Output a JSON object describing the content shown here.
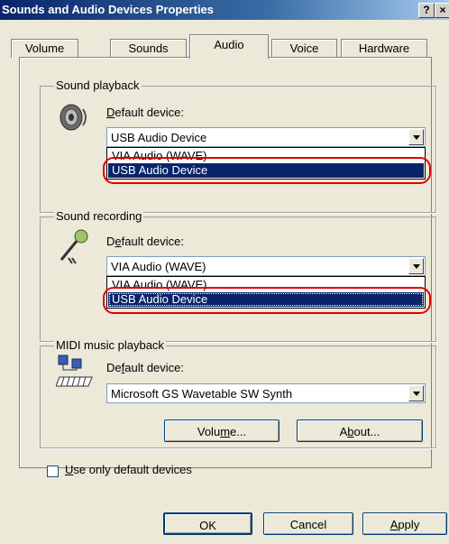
{
  "window": {
    "title": "Sounds and Audio Devices Properties",
    "help_glyph": "?",
    "close_glyph": "×"
  },
  "tabs": [
    "Volume",
    "Sounds",
    "Audio",
    "Voice",
    "Hardware"
  ],
  "active_tab": "Audio",
  "playback": {
    "group_label": "Sound playback",
    "default_label_prefix": "",
    "default_label_mnemonic": "D",
    "default_label_rest": "efault device:",
    "selected": "USB Audio Device",
    "options": [
      "VIA Audio (WAVE)",
      "USB Audio Device"
    ],
    "highlighted": "USB Audio Device",
    "icon": "speaker-icon"
  },
  "recording": {
    "group_label": "Sound recording",
    "default_label_prefix": "D",
    "default_label_mnemonic": "e",
    "default_label_rest": "fault device:",
    "selected": "VIA Audio (WAVE)",
    "options": [
      "VIA Audio (WAVE)",
      "USB Audio Device"
    ],
    "highlighted": "USB Audio Device",
    "icon": "microphone-icon"
  },
  "midi": {
    "group_label": "MIDI music playback",
    "default_label_prefix": "De",
    "default_label_mnemonic": "f",
    "default_label_rest": "ault device:",
    "selected": "Microsoft GS Wavetable SW Synth",
    "icon": "midi-keyboard-icon",
    "volume_prefix": "Volu",
    "volume_mnemonic": "m",
    "volume_rest": "e...",
    "about_prefix": "A",
    "about_mnemonic": "b",
    "about_rest": "out..."
  },
  "use_default": {
    "mnemonic": "U",
    "rest": "se only default devices",
    "checked": false
  },
  "footer": {
    "ok": "OK",
    "cancel": "Cancel",
    "apply_mnemonic": "A",
    "apply_rest": "pply"
  },
  "colors": {
    "title_start": "#0a246a",
    "selection": "#0a246a",
    "annotation_ring": "#e00000",
    "dialog_bg": "#ece9d8"
  }
}
